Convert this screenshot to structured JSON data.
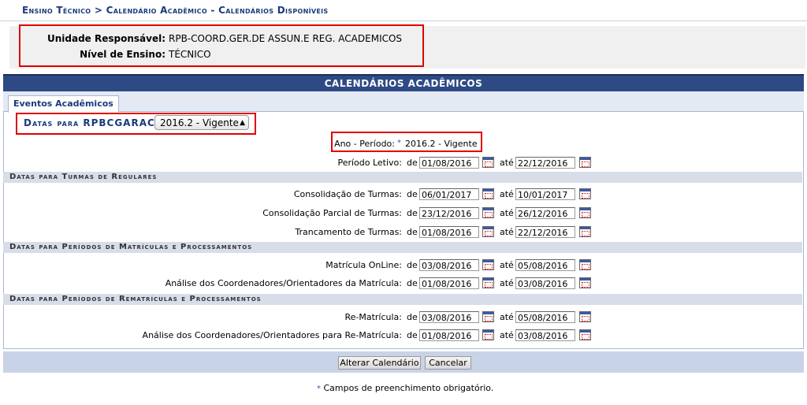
{
  "breadcrumb": "Ensino Técnico > Calendário Acadêmico - Calendários Disponíveis",
  "info": {
    "unidade_label": "Unidade Responsável:",
    "unidade_value": "RPB-COORD.GER.DE ASSUN.E REG. ACADEMICOS",
    "nivel_label": "Nível de Ensino:",
    "nivel_value": "TÉCNICO"
  },
  "caption": "CALENDÁRIOS ACADÊMICOS",
  "tab": "Eventos Acadêmicos",
  "datas_para": "Datas para RPBCGARAC",
  "select_value": "2016.2 - Vigente",
  "ano_periodo": {
    "label": "Ano - Período:",
    "star": "*",
    "value": "2016.2 - Vigente"
  },
  "common": {
    "de": "de",
    "ate": "até"
  },
  "periodo_letivo": {
    "label": "Período Letivo:",
    "from": "01/08/2016",
    "to": "22/12/2016"
  },
  "sections": {
    "regulares": "Datas para Turmas de Regulares",
    "matriculas": "Datas para Períodos de Matrículas e Processamentos",
    "rematriculas": "Datas para Períodos de Rematrículas e Processamentos"
  },
  "rows": {
    "consolidacao": {
      "label": "Consolidação de Turmas:",
      "from": "06/01/2017",
      "to": "10/01/2017"
    },
    "consolidacao_parcial": {
      "label": "Consolidação Parcial de Turmas:",
      "from": "23/12/2016",
      "to": "26/12/2016"
    },
    "trancamento": {
      "label": "Trancamento de Turmas:",
      "from": "01/08/2016",
      "to": "22/12/2016"
    },
    "matricula_online": {
      "label": "Matrícula OnLine:",
      "from": "03/08/2016",
      "to": "05/08/2016"
    },
    "analise_matricula": {
      "label": "Análise dos Coordenadores/Orientadores da Matrícula:",
      "from": "01/08/2016",
      "to": "03/08/2016"
    },
    "rematricula": {
      "label": "Re-Matrícula:",
      "from": "03/08/2016",
      "to": "05/08/2016"
    },
    "analise_rematricula": {
      "label": "Análise dos Coordenadores/Orientadores para Re-Matrícula:",
      "from": "01/08/2016",
      "to": "03/08/2016"
    }
  },
  "buttons": {
    "alterar": "Alterar Calendário",
    "cancelar": "Cancelar"
  },
  "footnote": {
    "star": "*",
    "text": "Campos de preenchimento obrigatório."
  },
  "colors": {
    "header_blue": "#2e4a84",
    "section_bg": "#d7dde9",
    "highlight_red": "#e00000"
  },
  "icons": [
    "calendar-icon",
    "required-star-icon",
    "select-arrow-icon"
  ]
}
